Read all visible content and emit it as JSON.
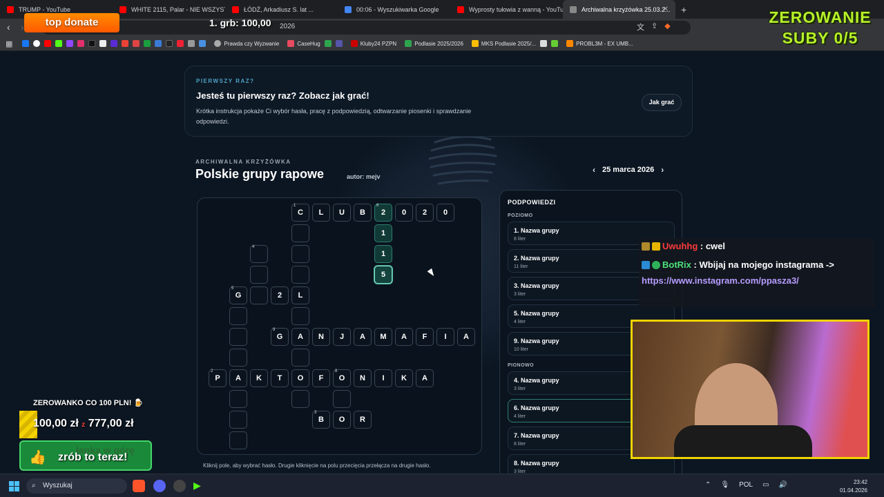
{
  "browser": {
    "tabs": [
      {
        "title": "TRUMP - YouTube",
        "color": "#ff0000"
      },
      {
        "title": "WHITE 2115, Palar - NIE WSZYSTKO ...",
        "color": "#ff0000"
      },
      {
        "title": "ŁÓDŹ, Arkadiusz S. lat ...",
        "color": "#ff0000"
      },
      {
        "title": "00:06 - Wyszukiwarka Google",
        "color": "#4285f4"
      },
      {
        "title": "Wyprosty tułowia z wanną - YouTube",
        "color": "#ff0000"
      },
      {
        "title": "Archiwalna krzyżówka 25.03.2...",
        "color": "#888888"
      }
    ],
    "url_fragment": "2026",
    "bookmarks": [
      "Prawda czy Wyzwanie",
      "CaseHug",
      "Kluby24 PZPN",
      "Podlasie 2025/2026",
      "MKS Podlasie 2025/...",
      "PROBL3M - EX UMB..."
    ]
  },
  "info": {
    "kicker": "PIERWSZY RAZ?",
    "title": "Jesteś tu pierwszy raz? Zobacz jak grać!",
    "description": "Krótka instrukcja pokaże Ci wybór hasła, pracę z podpowiedzią, odtwarzanie piosenki i sprawdzanie odpowiedzi.",
    "button": "Jak grać"
  },
  "puzzle": {
    "kicker": "ARCHIWALNA KRZYŻÓWKA",
    "title": "Polskie grupy rapowe",
    "author": "autor: mejv",
    "date": "25 marca 2026",
    "prev_arrow": "‹",
    "next_arrow": "›",
    "hint": "Kliknij pole, aby wybrać hasło. Drugie kliknięcie na polu przecięcia przełącza na drugie hasło.",
    "rows": [
      {
        "y": 0,
        "cells": [
          {
            "x": 4,
            "l": "C",
            "n": "1"
          },
          {
            "x": 5,
            "l": "L"
          },
          {
            "x": 6,
            "l": "U"
          },
          {
            "x": 7,
            "l": "B"
          },
          {
            "x": 8,
            "l": "2",
            "n": "6",
            "s": "hl"
          },
          {
            "x": 9,
            "l": "0"
          },
          {
            "x": 10,
            "l": "2"
          },
          {
            "x": 11,
            "l": "0"
          }
        ]
      },
      {
        "y": 1,
        "cells": [
          {
            "x": 4,
            "l": ""
          },
          {
            "x": 8,
            "l": "1",
            "s": "hl"
          }
        ]
      },
      {
        "y": 2,
        "cells": [
          {
            "x": 2,
            "l": "",
            "n": "4"
          },
          {
            "x": 4,
            "l": ""
          },
          {
            "x": 8,
            "l": "1",
            "s": "hl"
          }
        ]
      },
      {
        "y": 3,
        "cells": [
          {
            "x": 2,
            "l": ""
          },
          {
            "x": 4,
            "l": ""
          },
          {
            "x": 8,
            "l": "5",
            "s": "sel"
          }
        ]
      },
      {
        "y": 4,
        "cells": [
          {
            "x": 1,
            "l": "G",
            "n": "5"
          },
          {
            "x": 2,
            "l": ""
          },
          {
            "x": 3,
            "l": "2"
          },
          {
            "x": 4,
            "l": "L"
          }
        ]
      },
      {
        "y": 5,
        "cells": [
          {
            "x": 1,
            "l": ""
          },
          {
            "x": 4,
            "l": ""
          }
        ]
      },
      {
        "y": 6,
        "cells": [
          {
            "x": 1,
            "l": ""
          },
          {
            "x": 3,
            "l": "G",
            "n": "9"
          },
          {
            "x": 4,
            "l": "A"
          },
          {
            "x": 5,
            "l": "N"
          },
          {
            "x": 6,
            "l": "J"
          },
          {
            "x": 7,
            "l": "A"
          },
          {
            "x": 8,
            "l": "M"
          },
          {
            "x": 9,
            "l": "A"
          },
          {
            "x": 10,
            "l": "F"
          },
          {
            "x": 11,
            "l": "I"
          },
          {
            "x": 12,
            "l": "A"
          }
        ]
      },
      {
        "y": 7,
        "cells": [
          {
            "x": 1,
            "l": ""
          },
          {
            "x": 4,
            "l": ""
          }
        ]
      },
      {
        "y": 8,
        "cells": [
          {
            "x": 0,
            "l": "P",
            "n": "2"
          },
          {
            "x": 1,
            "l": "A"
          },
          {
            "x": 2,
            "l": "K"
          },
          {
            "x": 3,
            "l": "T"
          },
          {
            "x": 4,
            "l": "O"
          },
          {
            "x": 5,
            "l": "F"
          },
          {
            "x": 6,
            "l": "O",
            "n": "8"
          },
          {
            "x": 7,
            "l": "N"
          },
          {
            "x": 8,
            "l": "I"
          },
          {
            "x": 9,
            "l": "K"
          },
          {
            "x": 10,
            "l": "A"
          }
        ]
      },
      {
        "y": 9,
        "cells": [
          {
            "x": 1,
            "l": ""
          },
          {
            "x": 4,
            "l": ""
          },
          {
            "x": 6,
            "l": ""
          }
        ]
      },
      {
        "y": 10,
        "cells": [
          {
            "x": 1,
            "l": ""
          },
          {
            "x": 5,
            "l": "B",
            "n": "3"
          },
          {
            "x": 6,
            "l": "O"
          },
          {
            "x": 7,
            "l": "R"
          }
        ]
      },
      {
        "y": 11,
        "cells": [
          {
            "x": 1,
            "l": ""
          }
        ]
      }
    ]
  },
  "clues": {
    "heading": "PODPOWIEDZI",
    "across_label": "POZIOMO",
    "down_label": "PIONOWO",
    "across": [
      {
        "title": "1. Nazwa grupy",
        "len": "8 liter"
      },
      {
        "title": "2. Nazwa grupy",
        "len": "11 liter"
      },
      {
        "title": "3. Nazwa grupy",
        "len": "3 liter"
      },
      {
        "title": "5. Nazwa grupy",
        "len": "4 liter"
      },
      {
        "title": "9. Nazwa grupy",
        "len": "10 liter"
      }
    ],
    "down": [
      {
        "title": "4. Nazwa grupy",
        "len": "3 liter"
      },
      {
        "title": "6. Nazwa grupy",
        "len": "4 liter",
        "active": true
      },
      {
        "title": "7. Nazwa grupy",
        "len": "8 liter"
      },
      {
        "title": "8. Nazwa grupy",
        "len": "3 liter"
      }
    ]
  },
  "stream": {
    "donate": "top donate",
    "grb": "1. grb: 100,00",
    "zerowanie": "ZEROWANIE",
    "suby": "SUBY 0/5",
    "chat": [
      {
        "user": "Uwuhhg",
        "msg": ": cwel"
      },
      {
        "user": "BotRix",
        "msg": ": Wbijaj na mojego instagrama ->"
      },
      {
        "user": "",
        "msg": "https://www.instagram.com/ppasza3/"
      }
    ],
    "zerowanko": "ZEROWANKO CO 100 PLN! 🍺",
    "progress_current": "100,00 zł",
    "progress_sep": "z",
    "progress_goal": "777,00 zł",
    "progress_fraction": 0.13,
    "lapka_top": "łapka w górę",
    "lapka_cta": "zrób to teraz!"
  },
  "taskbar": {
    "search": "Wyszukaj",
    "lang": "POL",
    "time": "23:42",
    "date": "01.04.2026"
  }
}
